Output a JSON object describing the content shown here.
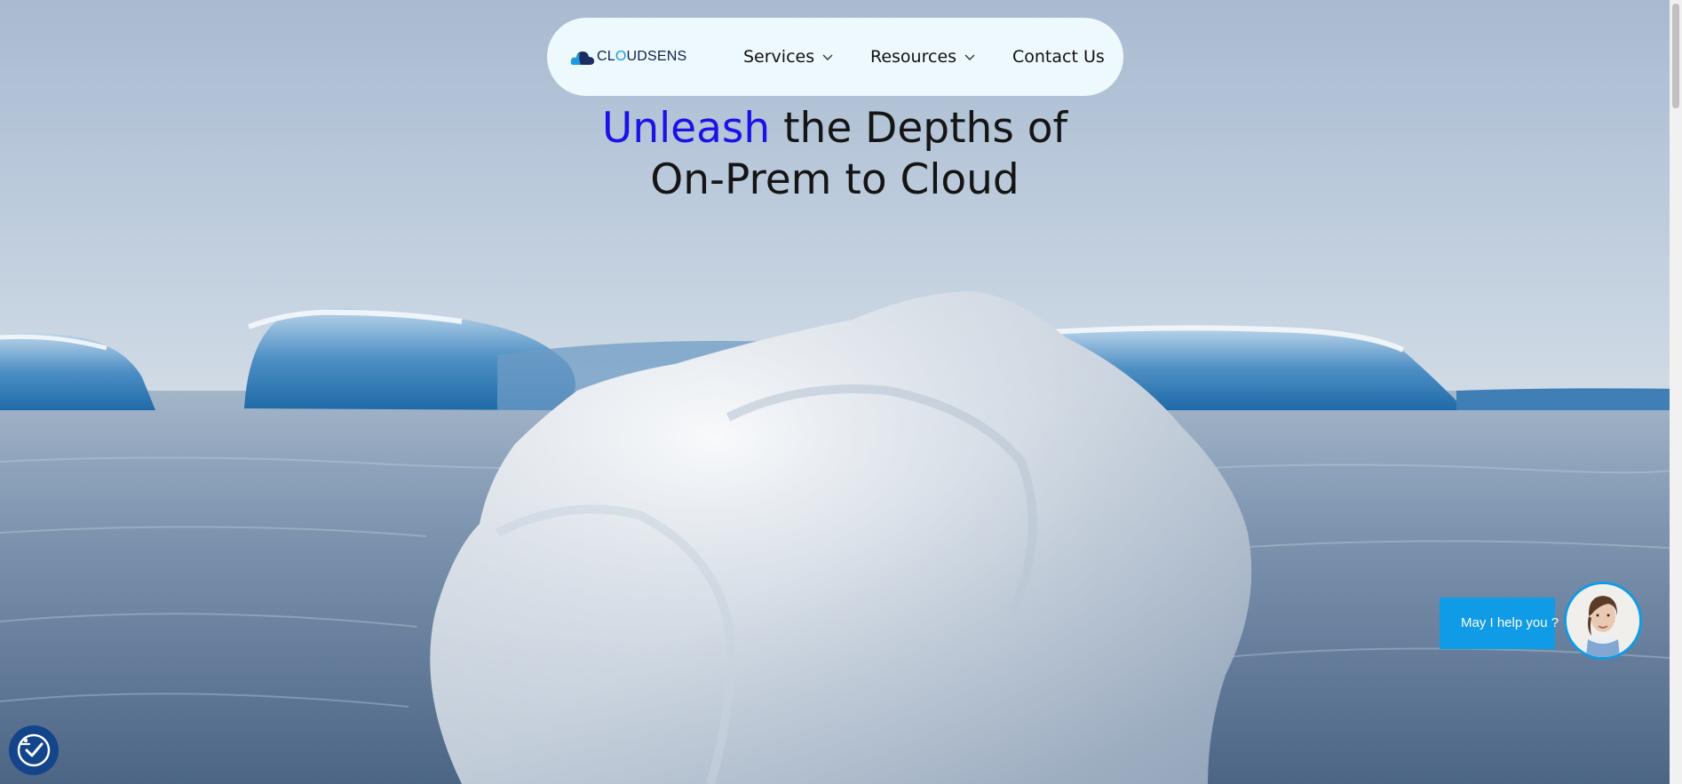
{
  "brand": {
    "name_pre": "CL",
    "name_accent": "O",
    "name_post": "UDSENS"
  },
  "nav": {
    "services_label": "Services",
    "resources_label": "Resources",
    "contact_label": "Contact Us"
  },
  "hero": {
    "headline_accent": "Unleash",
    "headline_rest": " the Depths of",
    "headline_line2": "On-Prem to Cloud"
  },
  "chat_widget": {
    "label": "May I help you ?"
  },
  "colors": {
    "accent_blue": "#1a12e6",
    "widget_blue": "#0f9be6",
    "nav_bg": "#eef9fd",
    "accessibility_bg": "#14448a"
  },
  "icons": [
    "cloud-logo-icon",
    "chevron-down-icon",
    "accessibility-icon",
    "assistant-avatar"
  ]
}
